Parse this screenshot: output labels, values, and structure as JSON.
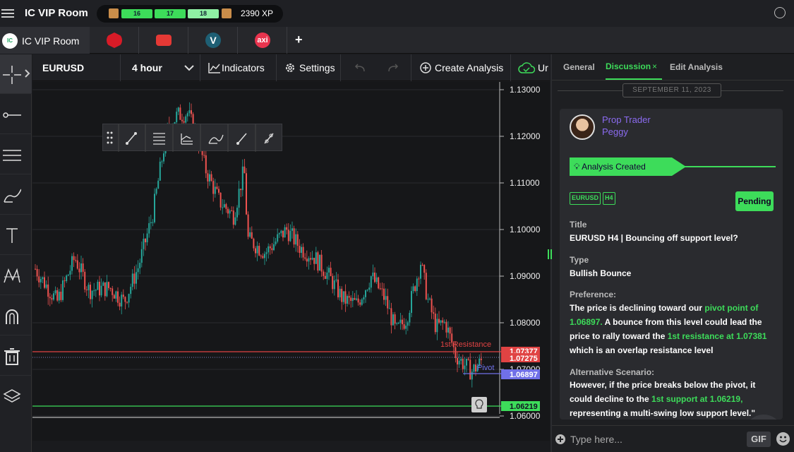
{
  "app": {
    "title": "IC VIP Room"
  },
  "xp": {
    "levels": [
      "16",
      "17",
      "18"
    ],
    "total": "2390 XP"
  },
  "broker_tabs": [
    {
      "label": "IC VIP Room",
      "logo_text": "IC",
      "active": true
    },
    {
      "icon": "hexagon-logo-icon",
      "color": "#d81b27"
    },
    {
      "icon": "tickmill-logo-icon",
      "color": "#e53935"
    },
    {
      "icon": "vantage-logo-icon",
      "color": "#1e5f74"
    },
    {
      "icon": "axi-logo-icon",
      "color": "#e8344e",
      "label": "axi"
    }
  ],
  "chart_toolbar": {
    "symbol": "EURUSD",
    "interval": "4 hour",
    "indicators": "Indicators",
    "settings": "Settings",
    "create_analysis": "Create Analysis",
    "cut_label": "Ur"
  },
  "left_tools": [
    "crosshair-icon",
    "line-icon",
    "fib-lines-icon",
    "brush-icon",
    "text-tool-icon",
    "pattern-icon",
    "magnet-icon",
    "trash-icon",
    "layers-icon"
  ],
  "chart": {
    "price_labels": [
      "1.13000",
      "1.12000",
      "1.11000",
      "1.10000",
      "1.09000",
      "1.08000",
      "1.07000",
      "1.06000"
    ],
    "markers": {
      "resistance": {
        "label": "1st Resistance",
        "price": "1.07377",
        "color": "#e04343"
      },
      "current": {
        "price": "1.07275",
        "color": "#e04343"
      },
      "pivot": {
        "label": "Pivot",
        "price": "1.06897",
        "color": "#7070e8"
      },
      "support": {
        "price": "1.06219",
        "color": "#3ddc5a"
      }
    }
  },
  "right_panel": {
    "tabs": [
      "General",
      "Discussion",
      "Edit Analysis"
    ],
    "date": "SEPTEMBER 11, 2023",
    "author": {
      "role": "Prop Trader",
      "name": "Peggy"
    },
    "banner": "Analysis Created",
    "tags": [
      "EURUSD",
      "H4"
    ],
    "status": "Pending",
    "title_label": "Title",
    "title": "EURUSD H4 | Bouncing off support level?",
    "type_label": "Type",
    "type": "Bullish Bounce",
    "preference_label": "Preference:",
    "preference": {
      "p1": "The price is declining toward our ",
      "h1": "pivot point of 1.06897.",
      "p2": " A bounce from this level could lead the price to rally toward the ",
      "h2": "1st resistance at 1.07381",
      "p3": " which is an overlap resistance level"
    },
    "alt_label": "Alternative Scenario:",
    "alternative": {
      "p1": " However, if the price breaks below the pivot, it could decline to the ",
      "h1": "1st support at 1.06219,",
      "p2": " representing a multi-swing low support level.\""
    },
    "chat_placeholder": "Type here...",
    "gif": "GIF"
  }
}
